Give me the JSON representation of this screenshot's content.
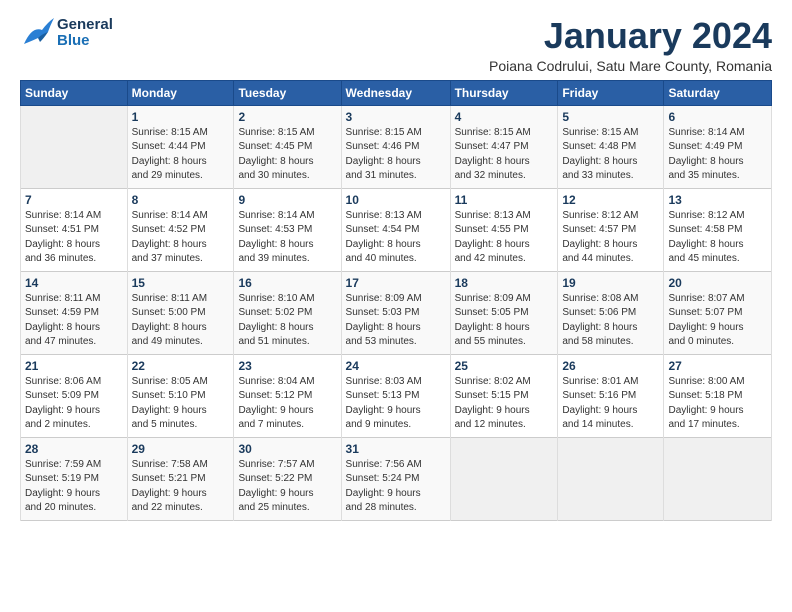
{
  "header": {
    "logo_general": "General",
    "logo_blue": "Blue",
    "month_title": "January 2024",
    "subtitle": "Poiana Codrului, Satu Mare County, Romania"
  },
  "weekdays": [
    "Sunday",
    "Monday",
    "Tuesday",
    "Wednesday",
    "Thursday",
    "Friday",
    "Saturday"
  ],
  "weeks": [
    [
      {
        "day": "",
        "info": ""
      },
      {
        "day": "1",
        "info": "Sunrise: 8:15 AM\nSunset: 4:44 PM\nDaylight: 8 hours\nand 29 minutes."
      },
      {
        "day": "2",
        "info": "Sunrise: 8:15 AM\nSunset: 4:45 PM\nDaylight: 8 hours\nand 30 minutes."
      },
      {
        "day": "3",
        "info": "Sunrise: 8:15 AM\nSunset: 4:46 PM\nDaylight: 8 hours\nand 31 minutes."
      },
      {
        "day": "4",
        "info": "Sunrise: 8:15 AM\nSunset: 4:47 PM\nDaylight: 8 hours\nand 32 minutes."
      },
      {
        "day": "5",
        "info": "Sunrise: 8:15 AM\nSunset: 4:48 PM\nDaylight: 8 hours\nand 33 minutes."
      },
      {
        "day": "6",
        "info": "Sunrise: 8:14 AM\nSunset: 4:49 PM\nDaylight: 8 hours\nand 35 minutes."
      }
    ],
    [
      {
        "day": "7",
        "info": "Sunrise: 8:14 AM\nSunset: 4:51 PM\nDaylight: 8 hours\nand 36 minutes."
      },
      {
        "day": "8",
        "info": "Sunrise: 8:14 AM\nSunset: 4:52 PM\nDaylight: 8 hours\nand 37 minutes."
      },
      {
        "day": "9",
        "info": "Sunrise: 8:14 AM\nSunset: 4:53 PM\nDaylight: 8 hours\nand 39 minutes."
      },
      {
        "day": "10",
        "info": "Sunrise: 8:13 AM\nSunset: 4:54 PM\nDaylight: 8 hours\nand 40 minutes."
      },
      {
        "day": "11",
        "info": "Sunrise: 8:13 AM\nSunset: 4:55 PM\nDaylight: 8 hours\nand 42 minutes."
      },
      {
        "day": "12",
        "info": "Sunrise: 8:12 AM\nSunset: 4:57 PM\nDaylight: 8 hours\nand 44 minutes."
      },
      {
        "day": "13",
        "info": "Sunrise: 8:12 AM\nSunset: 4:58 PM\nDaylight: 8 hours\nand 45 minutes."
      }
    ],
    [
      {
        "day": "14",
        "info": "Sunrise: 8:11 AM\nSunset: 4:59 PM\nDaylight: 8 hours\nand 47 minutes."
      },
      {
        "day": "15",
        "info": "Sunrise: 8:11 AM\nSunset: 5:00 PM\nDaylight: 8 hours\nand 49 minutes."
      },
      {
        "day": "16",
        "info": "Sunrise: 8:10 AM\nSunset: 5:02 PM\nDaylight: 8 hours\nand 51 minutes."
      },
      {
        "day": "17",
        "info": "Sunrise: 8:09 AM\nSunset: 5:03 PM\nDaylight: 8 hours\nand 53 minutes."
      },
      {
        "day": "18",
        "info": "Sunrise: 8:09 AM\nSunset: 5:05 PM\nDaylight: 8 hours\nand 55 minutes."
      },
      {
        "day": "19",
        "info": "Sunrise: 8:08 AM\nSunset: 5:06 PM\nDaylight: 8 hours\nand 58 minutes."
      },
      {
        "day": "20",
        "info": "Sunrise: 8:07 AM\nSunset: 5:07 PM\nDaylight: 9 hours\nand 0 minutes."
      }
    ],
    [
      {
        "day": "21",
        "info": "Sunrise: 8:06 AM\nSunset: 5:09 PM\nDaylight: 9 hours\nand 2 minutes."
      },
      {
        "day": "22",
        "info": "Sunrise: 8:05 AM\nSunset: 5:10 PM\nDaylight: 9 hours\nand 5 minutes."
      },
      {
        "day": "23",
        "info": "Sunrise: 8:04 AM\nSunset: 5:12 PM\nDaylight: 9 hours\nand 7 minutes."
      },
      {
        "day": "24",
        "info": "Sunrise: 8:03 AM\nSunset: 5:13 PM\nDaylight: 9 hours\nand 9 minutes."
      },
      {
        "day": "25",
        "info": "Sunrise: 8:02 AM\nSunset: 5:15 PM\nDaylight: 9 hours\nand 12 minutes."
      },
      {
        "day": "26",
        "info": "Sunrise: 8:01 AM\nSunset: 5:16 PM\nDaylight: 9 hours\nand 14 minutes."
      },
      {
        "day": "27",
        "info": "Sunrise: 8:00 AM\nSunset: 5:18 PM\nDaylight: 9 hours\nand 17 minutes."
      }
    ],
    [
      {
        "day": "28",
        "info": "Sunrise: 7:59 AM\nSunset: 5:19 PM\nDaylight: 9 hours\nand 20 minutes."
      },
      {
        "day": "29",
        "info": "Sunrise: 7:58 AM\nSunset: 5:21 PM\nDaylight: 9 hours\nand 22 minutes."
      },
      {
        "day": "30",
        "info": "Sunrise: 7:57 AM\nSunset: 5:22 PM\nDaylight: 9 hours\nand 25 minutes."
      },
      {
        "day": "31",
        "info": "Sunrise: 7:56 AM\nSunset: 5:24 PM\nDaylight: 9 hours\nand 28 minutes."
      },
      {
        "day": "",
        "info": ""
      },
      {
        "day": "",
        "info": ""
      },
      {
        "day": "",
        "info": ""
      }
    ]
  ]
}
